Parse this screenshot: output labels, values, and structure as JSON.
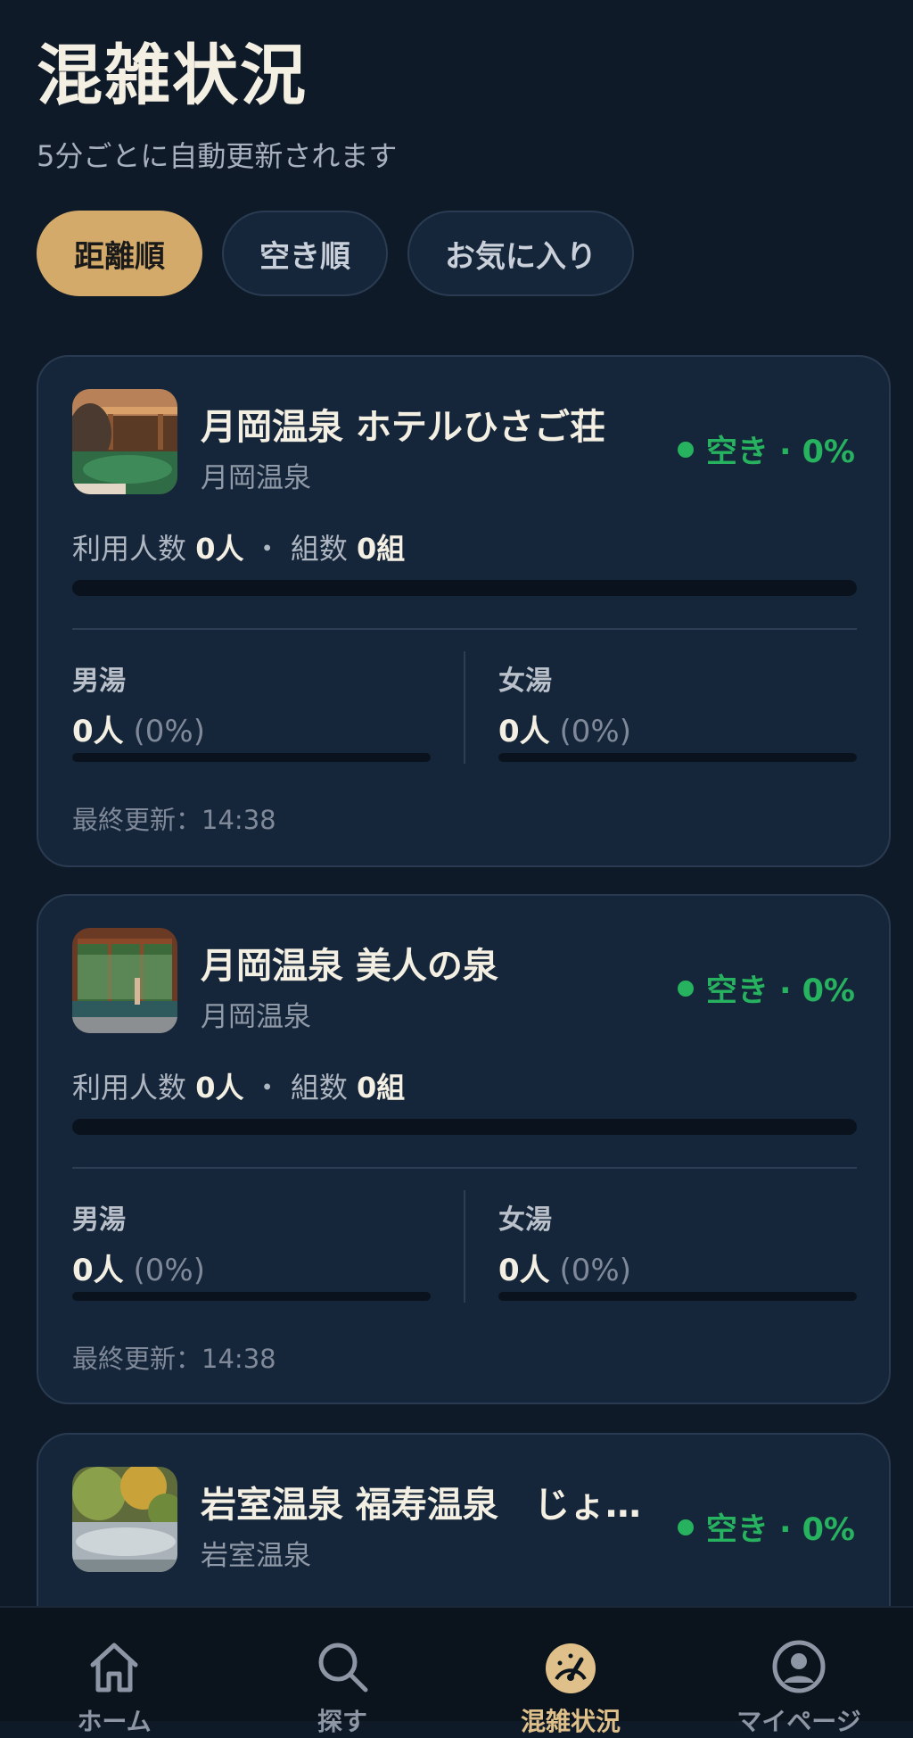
{
  "header": {
    "title": "混雑状況",
    "subtitle": "5分ごとに自動更新されます"
  },
  "filters": [
    {
      "label": "距離順",
      "active": true
    },
    {
      "label": "空き順",
      "active": false
    },
    {
      "label": "お気に入り",
      "active": false
    }
  ],
  "common": {
    "usage_label": "利用人数",
    "groups_label": "組数",
    "separator": "・",
    "male_label": "男湯",
    "female_label": "女湯",
    "updated_label": "最終更新："
  },
  "facilities": [
    {
      "name": "月岡温泉 ホテルひさご荘",
      "area": "月岡温泉",
      "status": "空き · 0%",
      "occupancy_pct": 0,
      "users": "0人",
      "groups": "0組",
      "male": {
        "count": "0人",
        "pct": "(0%)",
        "fill": 0
      },
      "female": {
        "count": "0人",
        "pct": "(0%)",
        "fill": 0
      },
      "updated": "14:38",
      "thumb_icon": "outdoor-bath-photo"
    },
    {
      "name": "月岡温泉 美人の泉",
      "area": "月岡温泉",
      "status": "空き · 0%",
      "occupancy_pct": 0,
      "users": "0人",
      "groups": "0組",
      "male": {
        "count": "0人",
        "pct": "(0%)",
        "fill": 0
      },
      "female": {
        "count": "0人",
        "pct": "(0%)",
        "fill": 0
      },
      "updated": "14:38",
      "thumb_icon": "indoor-bath-photo"
    },
    {
      "name": "岩室温泉 福寿温泉　じょ…",
      "area": "岩室温泉",
      "status": "空き · 0%",
      "thumb_icon": "garden-bath-photo"
    }
  ],
  "tabbar": [
    {
      "label": "ホーム",
      "icon": "home-icon",
      "active": false
    },
    {
      "label": "探す",
      "icon": "search-icon",
      "active": false
    },
    {
      "label": "混雑状況",
      "icon": "gauge-icon",
      "active": true
    },
    {
      "label": "マイページ",
      "icon": "user-icon",
      "active": false
    }
  ],
  "colors": {
    "background": "#0f1a28",
    "card": "#16263a",
    "accent": "#d4aa6a",
    "status_green": "#26b25f"
  }
}
